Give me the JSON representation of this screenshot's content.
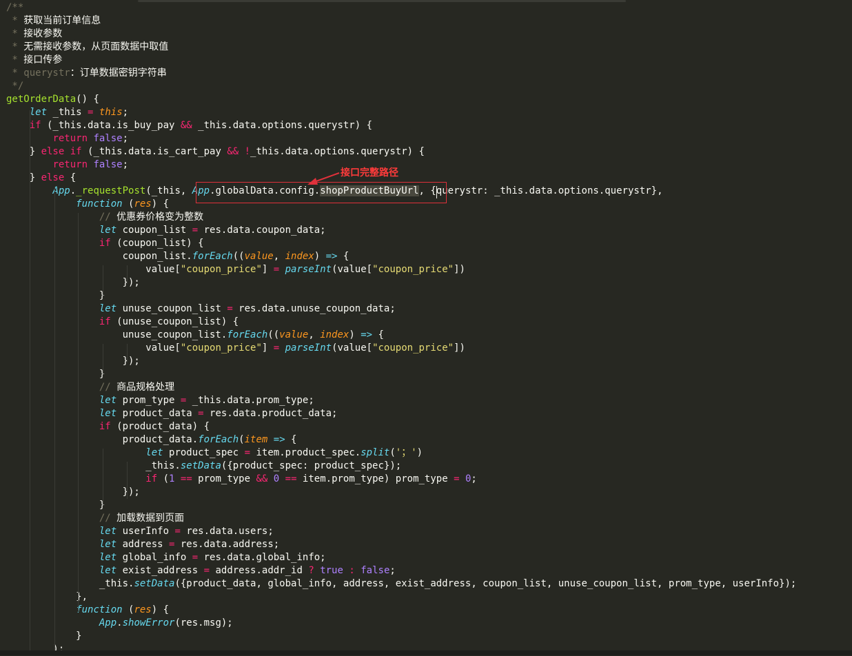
{
  "editor": {
    "lines": [
      [
        [
          "cm",
          "/**"
        ]
      ],
      [
        [
          "cm",
          " * "
        ],
        [
          "cmcn",
          "获取当前订单信息"
        ]
      ],
      [
        [
          "cm",
          " * "
        ],
        [
          "cmcn",
          "接收参数"
        ]
      ],
      [
        [
          "cm",
          " * "
        ],
        [
          "cmcn",
          "无需接收参数，从页面数据中取值"
        ]
      ],
      [
        [
          "cm",
          " * "
        ],
        [
          "cmcn",
          "接口传参"
        ]
      ],
      [
        [
          "cm",
          " * querystr"
        ],
        [
          "cmcn",
          "：订单数据密钥字符串"
        ]
      ],
      [
        [
          "cm",
          " */"
        ]
      ],
      [
        [
          "fn",
          "getOrderData"
        ],
        [
          "tx",
          "() {"
        ]
      ],
      [
        [
          "tx",
          "    "
        ],
        [
          "st",
          "let"
        ],
        [
          "tx",
          " _this "
        ],
        [
          "kw",
          "="
        ],
        [
          "tx",
          " "
        ],
        [
          "pa",
          "this"
        ],
        [
          "tx",
          ";"
        ]
      ],
      [
        [
          "tx",
          "    "
        ],
        [
          "kw",
          "if"
        ],
        [
          "tx",
          " (_this.data.is_buy_pay "
        ],
        [
          "kw",
          "&&"
        ],
        [
          "tx",
          " _this.data.options.querystr) {"
        ]
      ],
      [
        [
          "tx",
          "        "
        ],
        [
          "kw",
          "return"
        ],
        [
          "tx",
          " "
        ],
        [
          "num",
          "false"
        ],
        [
          "tx",
          ";"
        ]
      ],
      [
        [
          "tx",
          "    } "
        ],
        [
          "kw",
          "else"
        ],
        [
          "tx",
          " "
        ],
        [
          "kw",
          "if"
        ],
        [
          "tx",
          " (_this.data.is_cart_pay "
        ],
        [
          "kw",
          "&&"
        ],
        [
          "tx",
          " "
        ],
        [
          "kw",
          "!"
        ],
        [
          "tx",
          "_this.data.options.querystr) {"
        ]
      ],
      [
        [
          "tx",
          "        "
        ],
        [
          "kw",
          "return"
        ],
        [
          "tx",
          " "
        ],
        [
          "num",
          "false"
        ],
        [
          "tx",
          ";"
        ]
      ],
      [
        [
          "tx",
          "    } "
        ],
        [
          "kw",
          "else"
        ],
        [
          "tx",
          " {"
        ]
      ],
      [
        [
          "tx",
          "        "
        ],
        [
          "st",
          "App"
        ],
        [
          "tx",
          "."
        ],
        [
          "fn",
          "_requestPost"
        ],
        [
          "tx",
          "(_this, "
        ],
        [
          "st",
          "App"
        ],
        [
          "tx",
          ".globalData.config."
        ],
        [
          "sel",
          "shopProductBuyUrl"
        ],
        [
          "tx",
          ", {querystr: _this.data.options.querystr},"
        ]
      ],
      [
        [
          "tx",
          "            "
        ],
        [
          "st",
          "function"
        ],
        [
          "tx",
          " ("
        ],
        [
          "pa",
          "res"
        ],
        [
          "tx",
          ") {"
        ]
      ],
      [
        [
          "tx",
          "                "
        ],
        [
          "cm",
          "// "
        ],
        [
          "cmcn",
          "优惠券价格变为整数"
        ]
      ],
      [
        [
          "tx",
          "                "
        ],
        [
          "st",
          "let"
        ],
        [
          "tx",
          " coupon_list "
        ],
        [
          "kw",
          "="
        ],
        [
          "tx",
          " res.data.coupon_data;"
        ]
      ],
      [
        [
          "tx",
          "                "
        ],
        [
          "kw",
          "if"
        ],
        [
          "tx",
          " (coupon_list) {"
        ]
      ],
      [
        [
          "tx",
          "                    coupon_list."
        ],
        [
          "cb",
          "forEach"
        ],
        [
          "tx",
          "(("
        ],
        [
          "pa",
          "value"
        ],
        [
          "tx",
          ", "
        ],
        [
          "pa",
          "index"
        ],
        [
          "tx",
          ") "
        ],
        [
          "st",
          "=>"
        ],
        [
          "tx",
          " {"
        ]
      ],
      [
        [
          "tx",
          "                        value["
        ],
        [
          "str",
          "\"coupon_price\""
        ],
        [
          "tx",
          "] "
        ],
        [
          "kw",
          "="
        ],
        [
          "tx",
          " "
        ],
        [
          "cb",
          "parseInt"
        ],
        [
          "tx",
          "(value["
        ],
        [
          "str",
          "\"coupon_price\""
        ],
        [
          "tx",
          "])"
        ]
      ],
      [
        [
          "tx",
          "                    });"
        ]
      ],
      [
        [
          "tx",
          "                }"
        ]
      ],
      [
        [
          "tx",
          "                "
        ],
        [
          "st",
          "let"
        ],
        [
          "tx",
          " unuse_coupon_list "
        ],
        [
          "kw",
          "="
        ],
        [
          "tx",
          " res.data.unuse_coupon_data;"
        ]
      ],
      [
        [
          "tx",
          "                "
        ],
        [
          "kw",
          "if"
        ],
        [
          "tx",
          " (unuse_coupon_list) {"
        ]
      ],
      [
        [
          "tx",
          "                    unuse_coupon_list."
        ],
        [
          "cb",
          "forEach"
        ],
        [
          "tx",
          "(("
        ],
        [
          "pa",
          "value"
        ],
        [
          "tx",
          ", "
        ],
        [
          "pa",
          "index"
        ],
        [
          "tx",
          ") "
        ],
        [
          "st",
          "=>"
        ],
        [
          "tx",
          " {"
        ]
      ],
      [
        [
          "tx",
          "                        value["
        ],
        [
          "str",
          "\"coupon_price\""
        ],
        [
          "tx",
          "] "
        ],
        [
          "kw",
          "="
        ],
        [
          "tx",
          " "
        ],
        [
          "cb",
          "parseInt"
        ],
        [
          "tx",
          "(value["
        ],
        [
          "str",
          "\"coupon_price\""
        ],
        [
          "tx",
          "])"
        ]
      ],
      [
        [
          "tx",
          "                    });"
        ]
      ],
      [
        [
          "tx",
          "                }"
        ]
      ],
      [
        [
          "tx",
          "                "
        ],
        [
          "cm",
          "// "
        ],
        [
          "cmcn",
          "商品规格处理"
        ]
      ],
      [
        [
          "tx",
          "                "
        ],
        [
          "st",
          "let"
        ],
        [
          "tx",
          " prom_type "
        ],
        [
          "kw",
          "="
        ],
        [
          "tx",
          " _this.data.prom_type;"
        ]
      ],
      [
        [
          "tx",
          "                "
        ],
        [
          "st",
          "let"
        ],
        [
          "tx",
          " product_data "
        ],
        [
          "kw",
          "="
        ],
        [
          "tx",
          " res.data.product_data;"
        ]
      ],
      [
        [
          "tx",
          "                "
        ],
        [
          "kw",
          "if"
        ],
        [
          "tx",
          " (product_data) {"
        ]
      ],
      [
        [
          "tx",
          "                    product_data."
        ],
        [
          "cb",
          "forEach"
        ],
        [
          "tx",
          "("
        ],
        [
          "pa",
          "item"
        ],
        [
          "tx",
          " "
        ],
        [
          "st",
          "=>"
        ],
        [
          "tx",
          " {"
        ]
      ],
      [
        [
          "tx",
          "                        "
        ],
        [
          "st",
          "let"
        ],
        [
          "tx",
          " product_spec "
        ],
        [
          "kw",
          "="
        ],
        [
          "tx",
          " item.product_spec."
        ],
        [
          "cb",
          "split"
        ],
        [
          "tx",
          "("
        ],
        [
          "str",
          "'；'"
        ],
        [
          "tx",
          ")"
        ]
      ],
      [
        [
          "tx",
          "                        _this."
        ],
        [
          "cb",
          "setData"
        ],
        [
          "tx",
          "({product_spec: product_spec});"
        ]
      ],
      [
        [
          "tx",
          "                        "
        ],
        [
          "kw",
          "if"
        ],
        [
          "tx",
          " ("
        ],
        [
          "num",
          "1"
        ],
        [
          "tx",
          " "
        ],
        [
          "kw",
          "=="
        ],
        [
          "tx",
          " prom_type "
        ],
        [
          "kw",
          "&&"
        ],
        [
          "tx",
          " "
        ],
        [
          "num",
          "0"
        ],
        [
          "tx",
          " "
        ],
        [
          "kw",
          "=="
        ],
        [
          "tx",
          " item.prom_type) prom_type "
        ],
        [
          "kw",
          "="
        ],
        [
          "tx",
          " "
        ],
        [
          "num",
          "0"
        ],
        [
          "tx",
          ";"
        ]
      ],
      [
        [
          "tx",
          "                    });"
        ]
      ],
      [
        [
          "tx",
          "                }"
        ]
      ],
      [
        [
          "tx",
          "                "
        ],
        [
          "cm",
          "// "
        ],
        [
          "cmcn",
          "加载数据到页面"
        ]
      ],
      [
        [
          "tx",
          "                "
        ],
        [
          "st",
          "let"
        ],
        [
          "tx",
          " userInfo "
        ],
        [
          "kw",
          "="
        ],
        [
          "tx",
          " res.data.users;"
        ]
      ],
      [
        [
          "tx",
          "                "
        ],
        [
          "st",
          "let"
        ],
        [
          "tx",
          " address "
        ],
        [
          "kw",
          "="
        ],
        [
          "tx",
          " res.data.address;"
        ]
      ],
      [
        [
          "tx",
          "                "
        ],
        [
          "st",
          "let"
        ],
        [
          "tx",
          " global_info "
        ],
        [
          "kw",
          "="
        ],
        [
          "tx",
          " res.data.global_info;"
        ]
      ],
      [
        [
          "tx",
          "                "
        ],
        [
          "st",
          "let"
        ],
        [
          "tx",
          " exist_address "
        ],
        [
          "kw",
          "="
        ],
        [
          "tx",
          " address.addr_id "
        ],
        [
          "kw",
          "?"
        ],
        [
          "tx",
          " "
        ],
        [
          "num",
          "true"
        ],
        [
          "tx",
          " "
        ],
        [
          "kw",
          ":"
        ],
        [
          "tx",
          " "
        ],
        [
          "num",
          "false"
        ],
        [
          "tx",
          ";"
        ]
      ],
      [
        [
          "tx",
          "                _this."
        ],
        [
          "cb",
          "setData"
        ],
        [
          "tx",
          "({product_data, global_info, address, exist_address, coupon_list, unuse_coupon_list, prom_type, userInfo});"
        ]
      ],
      [
        [
          "tx",
          "            },"
        ]
      ],
      [
        [
          "tx",
          "            "
        ],
        [
          "st",
          "function"
        ],
        [
          "tx",
          " ("
        ],
        [
          "pa",
          "res"
        ],
        [
          "tx",
          ") {"
        ]
      ],
      [
        [
          "tx",
          "                "
        ],
        [
          "st",
          "App"
        ],
        [
          "tx",
          "."
        ],
        [
          "cb",
          "showError"
        ],
        [
          "tx",
          "(res.msg);"
        ]
      ],
      [
        [
          "tx",
          "            }"
        ]
      ],
      [
        [
          "tx",
          "        );"
        ]
      ]
    ]
  },
  "annotation": {
    "label": "接口完整路径",
    "color": "#e0313b"
  }
}
